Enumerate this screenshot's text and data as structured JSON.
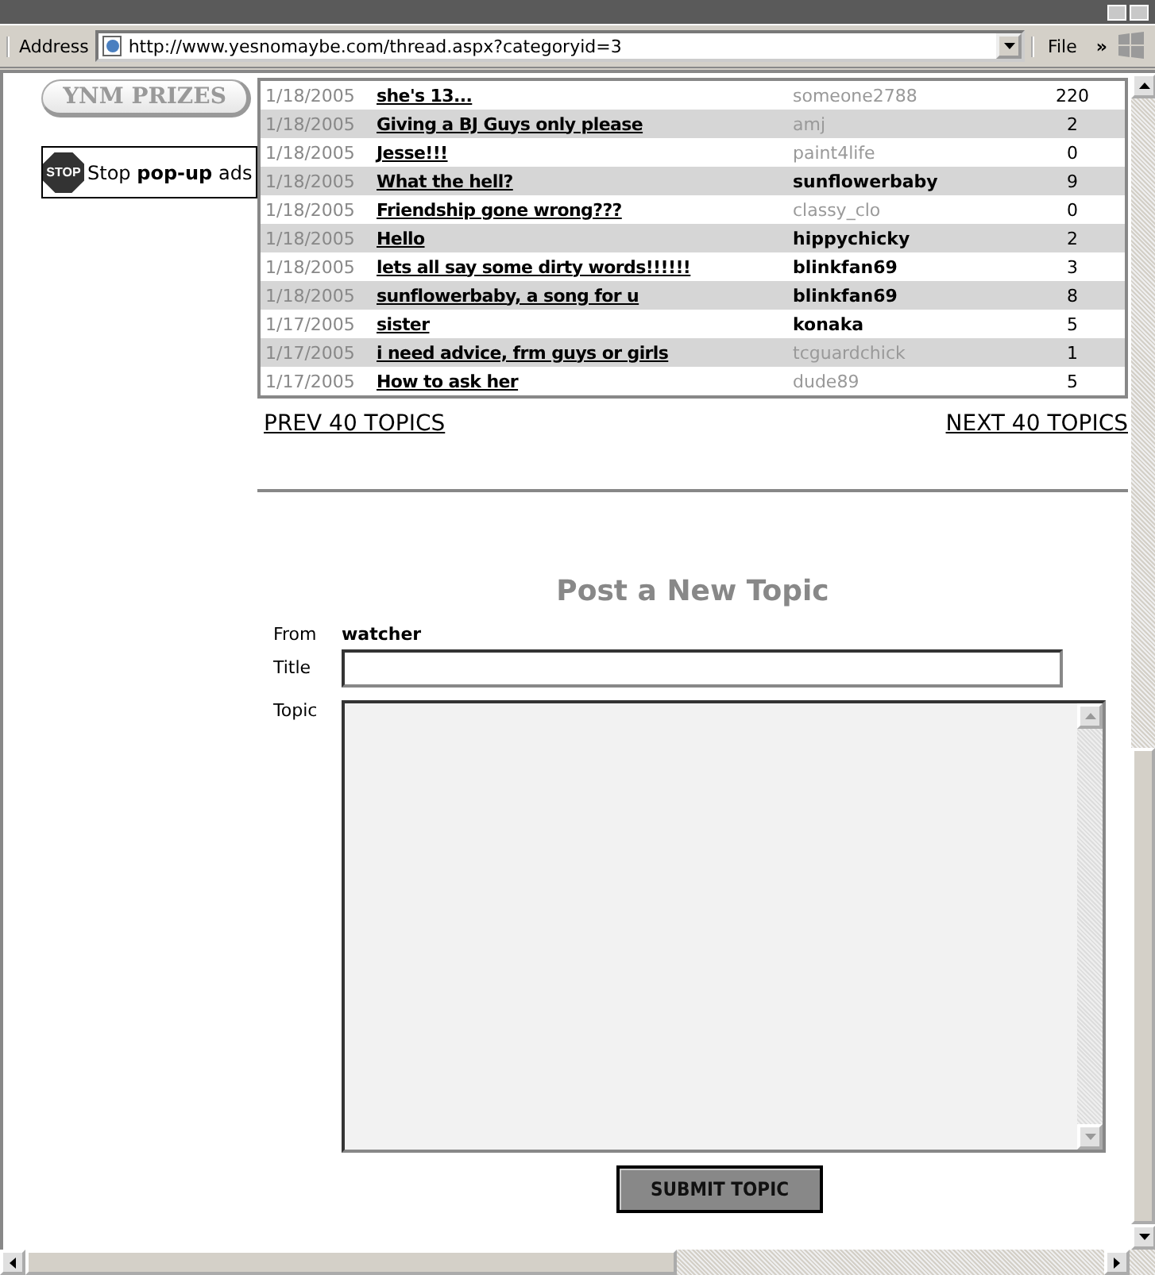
{
  "toolbar": {
    "address_label": "Address",
    "url": "http://www.yesnomaybe.com/thread.aspx?categoryid=3",
    "menu": "File",
    "chevron": "»"
  },
  "sidebar": {
    "prizes_button": "YNM PRIZES",
    "ad": {
      "icon_text": "STOP",
      "text": "Stop **pop-up** ads"
    }
  },
  "topics": [
    {
      "date": "1/18/2005",
      "title": "she's 13...",
      "author": "someone2788",
      "emphasized": false,
      "replies": "220"
    },
    {
      "date": "1/18/2005",
      "title": "Giving a BJ Guys only please",
      "author": "amj",
      "emphasized": false,
      "replies": "2"
    },
    {
      "date": "1/18/2005",
      "title": "Jesse!!!",
      "author": "paint4life",
      "emphasized": false,
      "replies": "0"
    },
    {
      "date": "1/18/2005",
      "title": "What the hell?",
      "author": "sunflowerbaby",
      "emphasized": true,
      "replies": "9"
    },
    {
      "date": "1/18/2005",
      "title": "Friendship gone wrong???",
      "author": "classy_clo",
      "emphasized": false,
      "replies": "0"
    },
    {
      "date": "1/18/2005",
      "title": "Hello",
      "author": "hippychicky",
      "emphasized": true,
      "replies": "2"
    },
    {
      "date": "1/18/2005",
      "title": "lets all say some dirty words!!!!!!",
      "author": "blinkfan69",
      "emphasized": true,
      "replies": "3"
    },
    {
      "date": "1/18/2005",
      "title": "sunflowerbaby, a song for u",
      "author": "blinkfan69",
      "emphasized": true,
      "replies": "8"
    },
    {
      "date": "1/17/2005",
      "title": "sister",
      "author": "konaka",
      "emphasized": true,
      "replies": "5"
    },
    {
      "date": "1/17/2005",
      "title": "i need advice, frm guys or girls",
      "author": "tcguardchick",
      "emphasized": false,
      "replies": "1"
    },
    {
      "date": "1/17/2005",
      "title": "How to ask her",
      "author": "dude89",
      "emphasized": false,
      "replies": "5"
    }
  ],
  "pager": {
    "prev": "PREV 40 TOPICS",
    "next": "NEXT 40 TOPICS"
  },
  "new_topic": {
    "heading": "Post a New Topic",
    "from_label": "From",
    "from_value": "watcher",
    "title_label": "Title",
    "topic_label": "Topic",
    "submit": "SUBMIT TOPIC"
  }
}
